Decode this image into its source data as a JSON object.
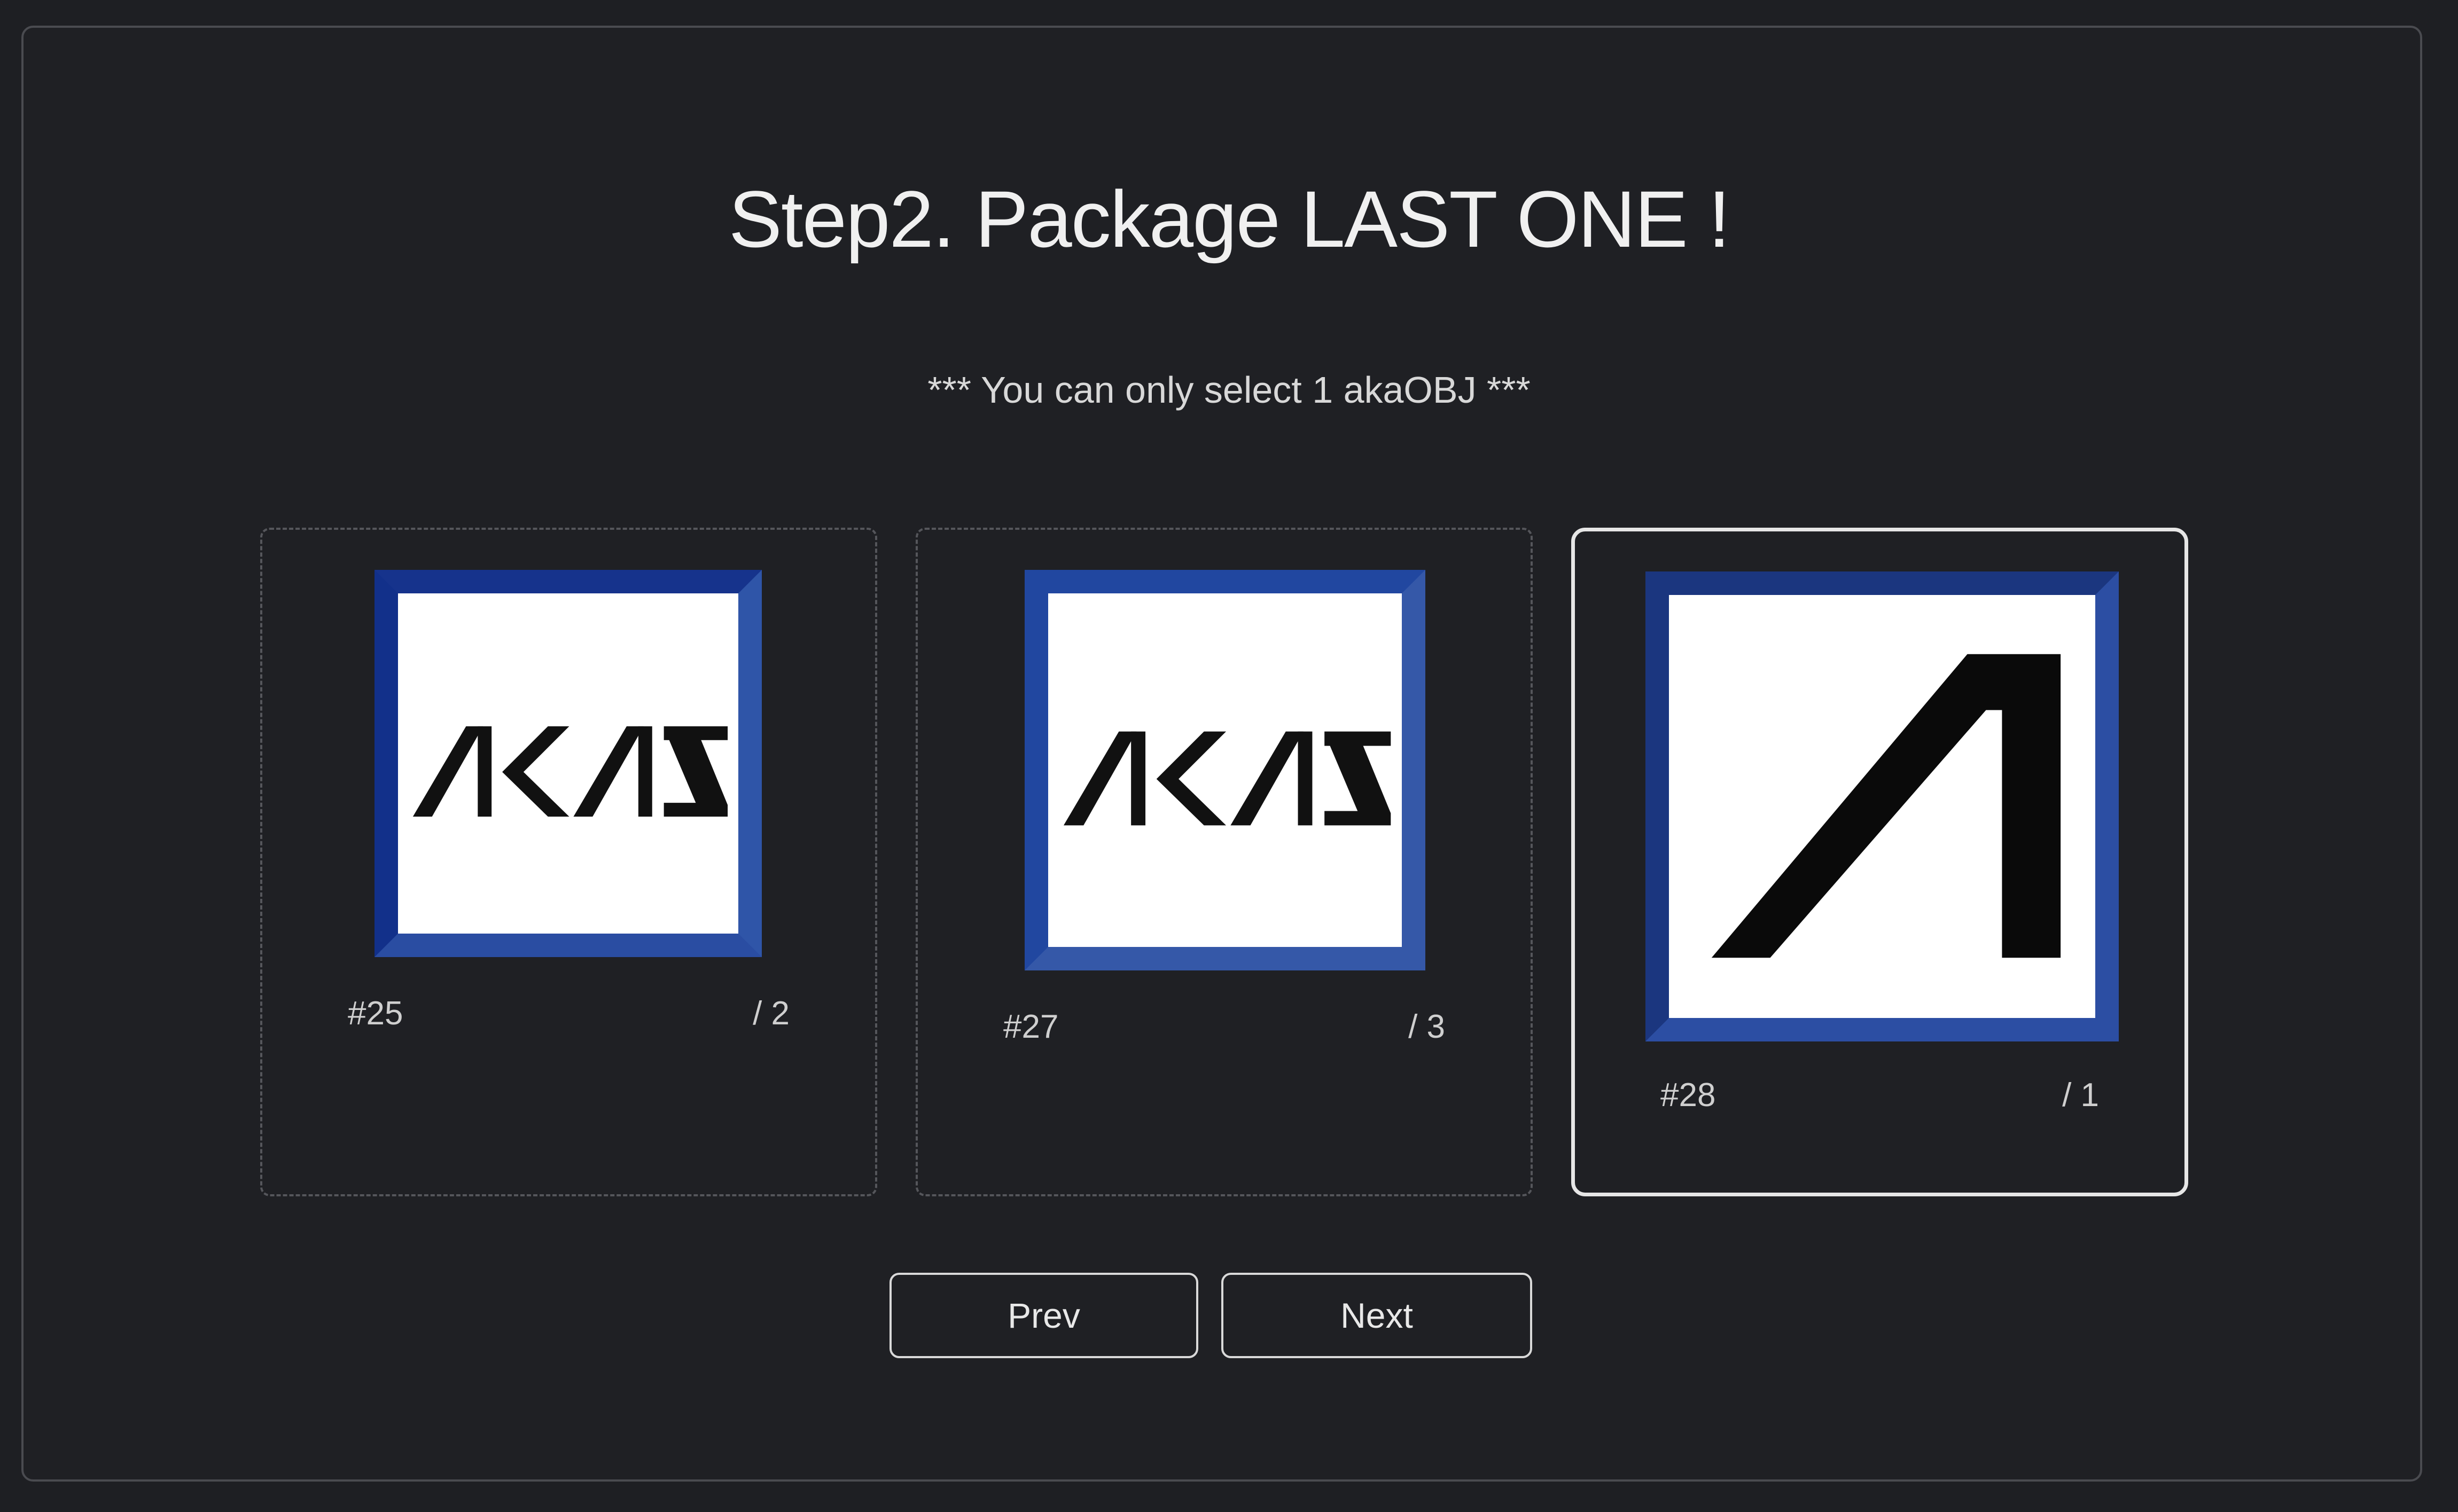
{
  "header": {
    "title": "Step2. Package LAST ONE !",
    "subtitle": "*** You can only select 1 akaOBJ ***"
  },
  "cards": [
    {
      "id_label": "#25",
      "count_label": "/ 2",
      "image": "akas-logo",
      "selected": false
    },
    {
      "id_label": "#27",
      "count_label": "/ 3",
      "image": "akas-logo",
      "selected": false
    },
    {
      "id_label": "#28",
      "count_label": "/ 1",
      "image": "a-logo",
      "selected": true
    }
  ],
  "buttons": {
    "prev": "Prev",
    "next": "Next"
  },
  "colors": {
    "background": "#1f2024",
    "frame_blue": "#2a4da2",
    "selected_border": "#e6e6e6"
  }
}
